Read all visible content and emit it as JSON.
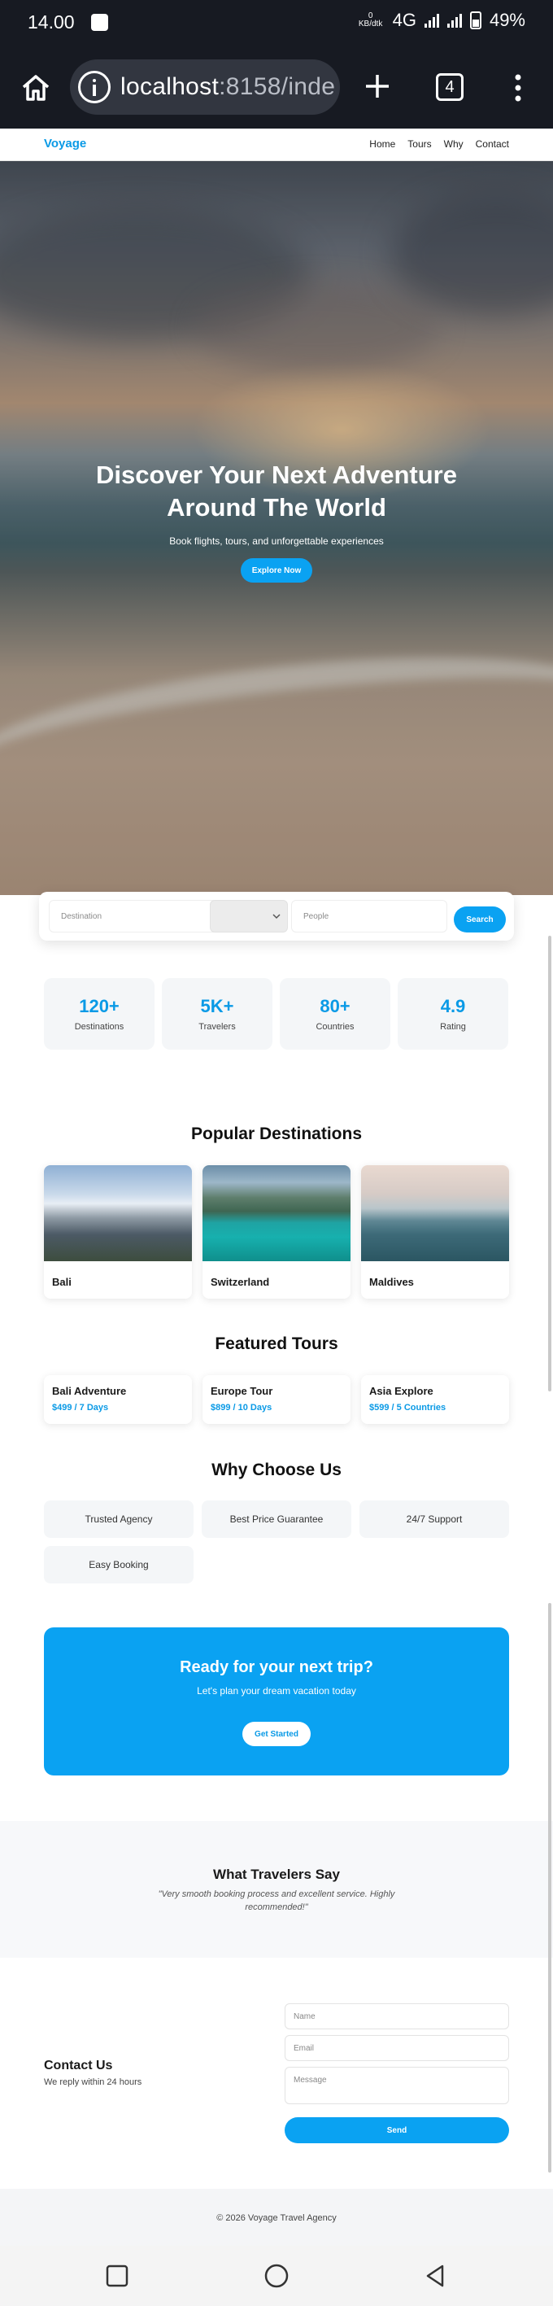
{
  "status_bar": {
    "time": "14.00",
    "data_rate": "0",
    "data_unit": "KB/dtk",
    "network": "4G",
    "battery": "49%"
  },
  "browser": {
    "url_host": "localhost",
    "url_rest": ":8158/inde",
    "tab_count": "4"
  },
  "site": {
    "logo": "Voyage",
    "nav": [
      "Home",
      "Tours",
      "Why",
      "Contact"
    ]
  },
  "hero": {
    "title_line1": "Discover Your Next Adventure",
    "title_line2": "Around The World",
    "subtitle": "Book flights, tours, and unforgettable experiences",
    "cta": "Explore Now"
  },
  "search": {
    "destination_placeholder": "Destination",
    "people_placeholder": "People",
    "button": "Search"
  },
  "stats": [
    {
      "value": "120+",
      "label": "Destinations"
    },
    {
      "value": "5K+",
      "label": "Travelers"
    },
    {
      "value": "80+",
      "label": "Countries"
    },
    {
      "value": "4.9",
      "label": "Rating"
    }
  ],
  "destinations": {
    "title": "Popular Destinations",
    "items": [
      {
        "name": "Bali"
      },
      {
        "name": "Switzerland"
      },
      {
        "name": "Maldives"
      }
    ]
  },
  "tours": {
    "title": "Featured Tours",
    "items": [
      {
        "name": "Bali Adventure",
        "price": "$499 / 7 Days"
      },
      {
        "name": "Europe Tour",
        "price": "$899 / 10 Days"
      },
      {
        "name": "Asia Explore",
        "price": "$599 / 5 Countries"
      }
    ]
  },
  "why": {
    "title": "Why Choose Us",
    "items": [
      "Trusted Agency",
      "Best Price Guarantee",
      "24/7 Support",
      "Easy Booking"
    ]
  },
  "banner": {
    "title": "Ready for your next trip?",
    "subtitle": "Let's plan your dream vacation today",
    "button": "Get Started"
  },
  "testimonials": {
    "title": "What Travelers Say",
    "quote_line1": "\"Very smooth booking process and excellent service. Highly",
    "quote_line2": "recommended!\""
  },
  "contact": {
    "title": "Contact Us",
    "subtitle": "We reply within 24 hours",
    "name_placeholder": "Name",
    "email_placeholder": "Email",
    "message_placeholder": "Message",
    "send": "Send"
  },
  "footer": {
    "text": "© 2026 Voyage Travel Agency"
  },
  "colors": {
    "accent": "#0aa2f2",
    "status_bar": "#171a22"
  }
}
